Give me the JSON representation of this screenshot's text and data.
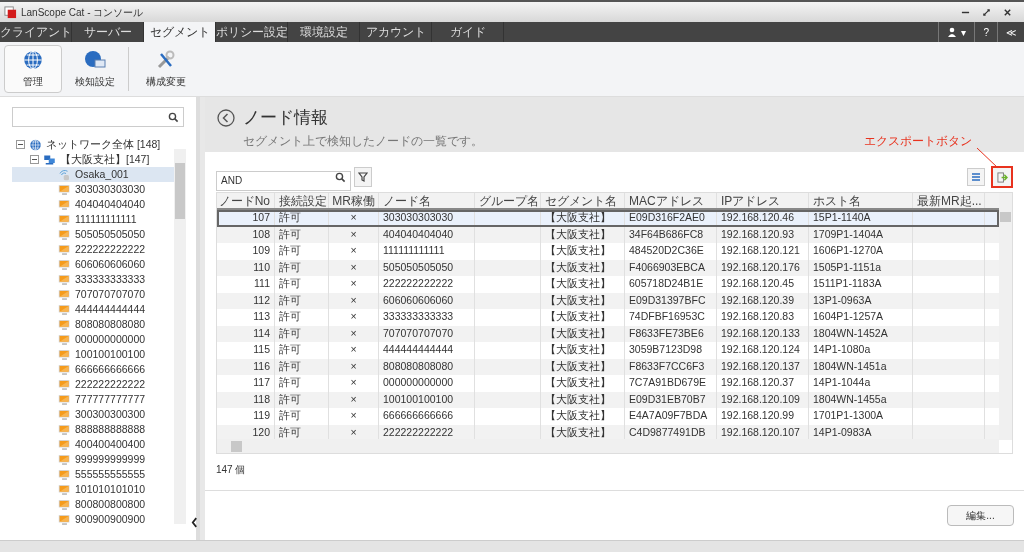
{
  "window": {
    "title": "LanScope Cat - コンソール"
  },
  "tabs": [
    {
      "label": "クライアント",
      "selected": false
    },
    {
      "label": "サーバー",
      "selected": false
    },
    {
      "label": "セグメント",
      "selected": true
    },
    {
      "label": "ポリシー設定",
      "selected": false
    },
    {
      "label": "環境設定",
      "selected": false
    },
    {
      "label": "アカウント",
      "selected": false
    },
    {
      "label": "ガイド",
      "selected": false
    }
  ],
  "header_buttons": [
    {
      "kind": "user",
      "label": "▾"
    },
    {
      "kind": "help",
      "label": "?"
    },
    {
      "kind": "collapse",
      "label": "≪"
    }
  ],
  "ribbon": [
    {
      "kind": "globe",
      "label": "管理",
      "selected": true
    },
    {
      "kind": "globe-monitor",
      "label": "検知設定",
      "selected": false
    },
    {
      "kind": "tools",
      "label": "構成変更",
      "selected": false
    }
  ],
  "tree": {
    "items": [
      {
        "label": "ネットワーク全体 [148]",
        "kind": "globe",
        "expanded": true,
        "children": [
          {
            "label": "【大阪支社】[147]",
            "kind": "network",
            "expanded": true,
            "children": [
              {
                "label": "Osaka_001",
                "kind": "sensor",
                "selected": true
              },
              {
                "label": "303030303030",
                "kind": "node",
                "selected": false
              },
              {
                "label": "404040404040",
                "kind": "node",
                "selected": false
              },
              {
                "label": "111111111111",
                "kind": "node",
                "selected": false
              },
              {
                "label": "505050505050",
                "kind": "node",
                "selected": false
              },
              {
                "label": "222222222222",
                "kind": "node",
                "selected": false
              },
              {
                "label": "606060606060",
                "kind": "node",
                "selected": false
              },
              {
                "label": "333333333333",
                "kind": "node",
                "selected": false
              },
              {
                "label": "707070707070",
                "kind": "node",
                "selected": false
              },
              {
                "label": "444444444444",
                "kind": "node",
                "selected": false
              },
              {
                "label": "808080808080",
                "kind": "node",
                "selected": false
              },
              {
                "label": "000000000000",
                "kind": "node",
                "selected": false
              },
              {
                "label": "100100100100",
                "kind": "node",
                "selected": false
              },
              {
                "label": "666666666666",
                "kind": "node",
                "selected": false
              },
              {
                "label": "222222222222",
                "kind": "node",
                "selected": false
              },
              {
                "label": "777777777777",
                "kind": "node",
                "selected": false
              },
              {
                "label": "300300300300",
                "kind": "node",
                "selected": false
              },
              {
                "label": "888888888888",
                "kind": "node",
                "selected": false
              },
              {
                "label": "400400400400",
                "kind": "node",
                "selected": false
              },
              {
                "label": "999999999999",
                "kind": "node",
                "selected": false
              },
              {
                "label": "555555555555",
                "kind": "node",
                "selected": false
              },
              {
                "label": "101010101010",
                "kind": "node",
                "selected": false
              },
              {
                "label": "800800800800",
                "kind": "node",
                "selected": false
              },
              {
                "label": "900900900900",
                "kind": "node",
                "selected": false
              }
            ]
          }
        ]
      }
    ]
  },
  "page": {
    "title": "ノード情報",
    "subtitle": "セグメント上で検知したノードの一覧です。"
  },
  "filter": {
    "value": "AND"
  },
  "annotation": {
    "text": "エクスポートボタン"
  },
  "table": {
    "columns": [
      "ノードNo",
      "接続設定",
      "MR稼働",
      "ノード名",
      "グループ名",
      "セグメント名",
      "MACアドレス",
      "IPアドレス",
      "ホスト名",
      "最新MR起..."
    ],
    "rows": [
      {
        "selected": true,
        "cells": [
          "107",
          "許可",
          "×",
          "303030303030",
          "",
          "【大阪支社】",
          "E09D316F2AE0",
          "192.168.120.46",
          "15P1-1140A",
          ""
        ]
      },
      {
        "selected": false,
        "cells": [
          "108",
          "許可",
          "×",
          "404040404040",
          "",
          "【大阪支社】",
          "34F64B686FC8",
          "192.168.120.93",
          "1709P1-1404A",
          ""
        ]
      },
      {
        "selected": false,
        "cells": [
          "109",
          "許可",
          "×",
          "111111111111",
          "",
          "【大阪支社】",
          "484520D2C36E",
          "192.168.120.121",
          "1606P1-1270A",
          ""
        ]
      },
      {
        "selected": false,
        "cells": [
          "110",
          "許可",
          "×",
          "505050505050",
          "",
          "【大阪支社】",
          "F4066903EBCA",
          "192.168.120.176",
          "1505P1-1151a",
          ""
        ]
      },
      {
        "selected": false,
        "cells": [
          "111",
          "許可",
          "×",
          "222222222222",
          "",
          "【大阪支社】",
          "605718D24B1E",
          "192.168.120.45",
          "1511P1-1183A",
          ""
        ]
      },
      {
        "selected": false,
        "cells": [
          "112",
          "許可",
          "×",
          "606060606060",
          "",
          "【大阪支社】",
          "E09D31397BFC",
          "192.168.120.39",
          "13P1-0963A",
          ""
        ]
      },
      {
        "selected": false,
        "cells": [
          "113",
          "許可",
          "×",
          "333333333333",
          "",
          "【大阪支社】",
          "74DFBF16953C",
          "192.168.120.83",
          "1604P1-1257A",
          ""
        ]
      },
      {
        "selected": false,
        "cells": [
          "114",
          "許可",
          "×",
          "707070707070",
          "",
          "【大阪支社】",
          "F8633FE73BE6",
          "192.168.120.133",
          "1804WN-1452A",
          ""
        ]
      },
      {
        "selected": false,
        "cells": [
          "115",
          "許可",
          "×",
          "444444444444",
          "",
          "【大阪支社】",
          "3059B7123D98",
          "192.168.120.124",
          "14P1-1080a",
          ""
        ]
      },
      {
        "selected": false,
        "cells": [
          "116",
          "許可",
          "×",
          "808080808080",
          "",
          "【大阪支社】",
          "F8633F7CC6F3",
          "192.168.120.137",
          "1804WN-1451a",
          ""
        ]
      },
      {
        "selected": false,
        "cells": [
          "117",
          "許可",
          "×",
          "000000000000",
          "",
          "【大阪支社】",
          "7C7A91BD679E",
          "192.168.120.37",
          "14P1-1044a",
          ""
        ]
      },
      {
        "selected": false,
        "cells": [
          "118",
          "許可",
          "×",
          "100100100100",
          "",
          "【大阪支社】",
          "E09D31EB70B7",
          "192.168.120.109",
          "1804WN-1455a",
          ""
        ]
      },
      {
        "selected": false,
        "cells": [
          "119",
          "許可",
          "×",
          "666666666666",
          "",
          "【大阪支社】",
          "E4A7A09F7BDA",
          "192.168.120.99",
          "1701P1-1300A",
          ""
        ]
      },
      {
        "selected": false,
        "cells": [
          "120",
          "許可",
          "×",
          "222222222222",
          "",
          "【大阪支社】",
          "C4D9877491DB",
          "192.168.120.107",
          "14P1-0983A",
          ""
        ]
      }
    ]
  },
  "count": "147 個",
  "buttons": [
    {
      "label": "編集..."
    }
  ]
}
